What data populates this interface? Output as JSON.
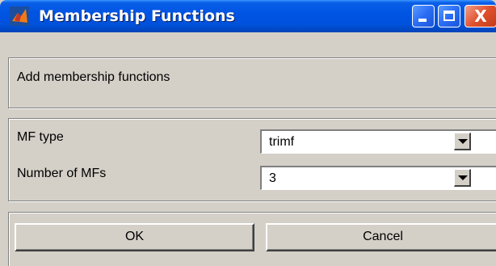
{
  "window": {
    "title": "Membership Functions",
    "icon": "matlab-icon",
    "minimize_icon": "minimize-icon",
    "maximize_icon": "maximize-icon",
    "close_icon": "close-icon",
    "close_glyph": "X"
  },
  "header": {
    "text": "Add membership functions"
  },
  "form": {
    "mf_type_label": "MF type",
    "mf_type_value": "trimf",
    "num_mfs_label": "Number of MFs",
    "num_mfs_value": "3"
  },
  "buttons": {
    "ok": "OK",
    "cancel": "Cancel"
  },
  "colors": {
    "titlebar": "#0054e3",
    "face": "#d4d0c8",
    "close": "#e0512e"
  }
}
